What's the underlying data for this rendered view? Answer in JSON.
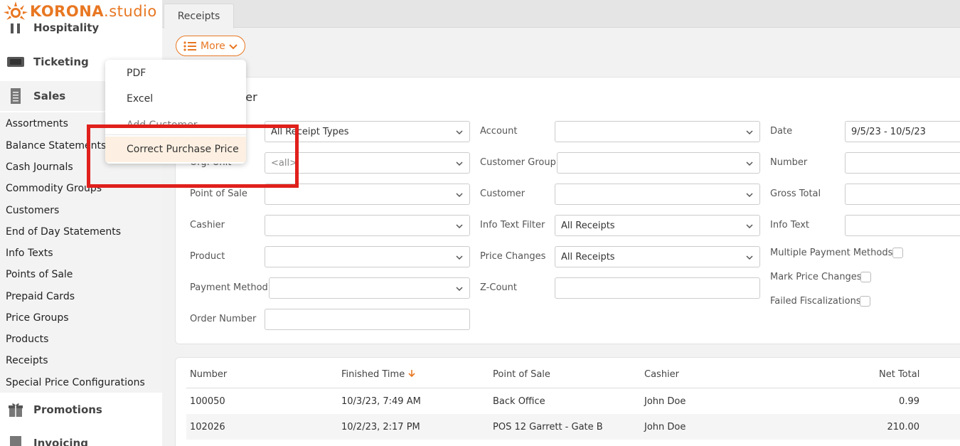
{
  "logo": {
    "brand": "KORONA",
    "suffix": ".studio"
  },
  "sidebar": {
    "sections": [
      {
        "label": "Hospitality",
        "icon": "hospitality-icon"
      },
      {
        "label": "Ticketing",
        "icon": "ticket-icon"
      },
      {
        "label": "Sales",
        "icon": "receipt-icon"
      },
      {
        "label": "Promotions",
        "icon": "gift-icon"
      },
      {
        "label": "Invoicing",
        "icon": "invoice-icon"
      }
    ],
    "sales_items": [
      "Assortments",
      "Balance Statements",
      "Cash Journals",
      "Commodity Groups",
      "Customers",
      "End of Day Statements",
      "Info Texts",
      "Points of Sale",
      "Prepaid Cards",
      "Price Groups",
      "Products",
      "Receipts",
      "Special Price Configurations"
    ]
  },
  "tabs": [
    {
      "label": "Receipts"
    }
  ],
  "toolbar": {
    "more_label": "More"
  },
  "dropdown": {
    "items": [
      "PDF",
      "Excel",
      "Add Customer",
      "Correct Purchase Price"
    ]
  },
  "filter": {
    "title_visible": "ter",
    "col1": [
      {
        "label": "",
        "value": "All Receipt Types",
        "placeholder": false
      },
      {
        "label": "Org. Unit",
        "value": "<all>",
        "placeholder": true
      },
      {
        "label": "Point of Sale",
        "value": ""
      },
      {
        "label": "Cashier",
        "value": ""
      },
      {
        "label": "Product",
        "value": ""
      },
      {
        "label": "Payment Method",
        "value": ""
      },
      {
        "label": "Order Number",
        "value": ""
      }
    ],
    "col2": [
      {
        "label": "Account",
        "value": ""
      },
      {
        "label": "Customer Group",
        "value": ""
      },
      {
        "label": "Customer",
        "value": ""
      },
      {
        "label": "Info Text Filter",
        "value": "All Receipts"
      },
      {
        "label": "Price Changes",
        "value": "All Receipts"
      },
      {
        "label": "Z-Count",
        "value": ""
      }
    ],
    "col3": [
      {
        "label": "Date",
        "value": "9/5/23 - 10/5/23"
      },
      {
        "label": "Number",
        "value": ""
      },
      {
        "label": "Gross Total",
        "value": ""
      },
      {
        "label": "Info Text",
        "value": ""
      }
    ],
    "checkboxes": [
      {
        "label": "Multiple Payment Methods",
        "checked": false
      },
      {
        "label": "Mark Price Changes",
        "checked": false
      },
      {
        "label": "Failed Fiscalizations",
        "checked": false
      }
    ]
  },
  "table": {
    "columns": [
      "Number",
      "Finished Time",
      "Point of Sale",
      "Cashier",
      "Net Total"
    ],
    "rows": [
      {
        "number": "100050",
        "time": "10/3/23, 7:49 AM",
        "pos": "Back Office",
        "cashier": "John Doe",
        "net": "0.99"
      },
      {
        "number": "102026",
        "time": "10/2/23, 2:17 PM",
        "pos": "POS 12 Garrett - Gate B",
        "cashier": "John Doe",
        "net": "210.00"
      }
    ]
  },
  "colors": {
    "accent": "#e87722",
    "highlight": "#e0201c"
  }
}
